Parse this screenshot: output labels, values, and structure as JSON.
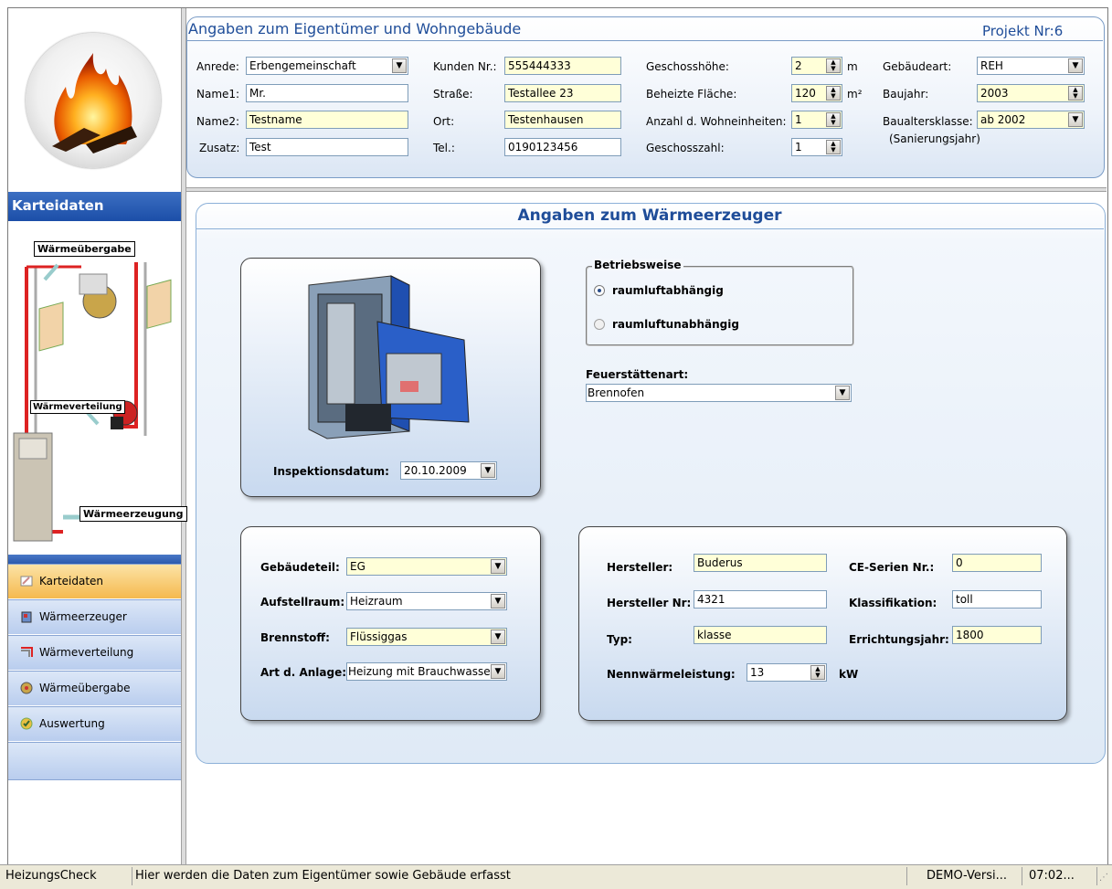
{
  "header": {
    "title": "Angaben zum Eigentümer und Wohngebäude",
    "project": "Projekt Nr:6",
    "fields": {
      "anrede": {
        "label": "Anrede:",
        "value": "Erbengemeinschaft"
      },
      "name1": {
        "label": "Name1:",
        "value": "Mr."
      },
      "name2": {
        "label": "Name2:",
        "value": "Testname"
      },
      "zusatz": {
        "label": "Zusatz:",
        "value": "Test"
      },
      "kunden_nr": {
        "label": "Kunden Nr.:",
        "value": "555444333"
      },
      "strasse": {
        "label": "Straße:",
        "value": "Testallee 23"
      },
      "ort": {
        "label": "Ort:",
        "value": "Testenhausen"
      },
      "tel": {
        "label": "Tel.:",
        "value": "0190123456"
      },
      "geschosshoehe": {
        "label": "Geschosshöhe:",
        "value": "2",
        "unit": "m"
      },
      "beheizte_flaeche": {
        "label": "Beheizte Fläche:",
        "value": "120",
        "unit": "m²"
      },
      "wohneinheiten": {
        "label": "Anzahl d. Wohneinheiten:",
        "value": "1"
      },
      "geschosszahl": {
        "label": "Geschosszahl:",
        "value": "1"
      },
      "gebaeudeart": {
        "label": "Gebäudeart:",
        "value": "REH"
      },
      "baujahr": {
        "label": "Baujahr:",
        "value": "2003"
      },
      "baualtersklasse": {
        "label": "Baualtersklasse:",
        "label2": "(Sanierungsjahr)",
        "value": "ab 2002"
      }
    }
  },
  "sidebar": {
    "header": "Karteidaten",
    "diagram_labels": {
      "uebergabe": "Wärmeübergabe",
      "verteilung": "Wärmeverteilung",
      "erzeugung": "Wärmeerzeugung"
    },
    "items": [
      {
        "label": "Karteidaten",
        "icon": "card-icon",
        "active": true
      },
      {
        "label": "Wärmeerzeuger",
        "icon": "boiler-icon",
        "active": false
      },
      {
        "label": "Wärmeverteilung",
        "icon": "distribution-icon",
        "active": false
      },
      {
        "label": "Wärmeübergabe",
        "icon": "radiator-icon",
        "active": false
      },
      {
        "label": "Auswertung",
        "icon": "evaluation-icon",
        "active": false
      }
    ]
  },
  "main": {
    "title": "Angaben zum Wärmeerzeuger",
    "inspektion": {
      "label": "Inspektionsdatum:",
      "value": "20.10.2009"
    },
    "betriebsweise": {
      "legend": "Betriebsweise",
      "options": [
        "raumluftabhängig",
        "raumluftunabhängig"
      ],
      "selected": 0
    },
    "feuerstaettenart": {
      "label": "Feuerstättenart:",
      "value": "Brennofen"
    },
    "left_box": {
      "gebaeudeteil": {
        "label": "Gebäudeteil:",
        "value": "EG"
      },
      "aufstellraum": {
        "label": "Aufstellraum:",
        "value": "Heizraum"
      },
      "brennstoff": {
        "label": "Brennstoff:",
        "value": "Flüssiggas"
      },
      "art_anlage": {
        "label": "Art d. Anlage:",
        "value": "Heizung mit Brauchwasse"
      }
    },
    "right_box": {
      "hersteller": {
        "label": "Hersteller:",
        "value": "Buderus"
      },
      "hersteller_nr": {
        "label": "Hersteller Nr:",
        "value": "4321"
      },
      "typ": {
        "label": "Typ:",
        "value": "klasse"
      },
      "nennwaermeleistung": {
        "label": "Nennwärmeleistung:",
        "value": "13",
        "unit": "kW"
      },
      "ce_serien_nr": {
        "label": "CE-Serien Nr.:",
        "value": "0"
      },
      "klassifikation": {
        "label": "Klassifikation:",
        "value": "toll"
      },
      "errichtungsjahr": {
        "label": "Errichtungsjahr:",
        "value": "1800"
      }
    }
  },
  "status": {
    "app": "HeizungsCheck",
    "message": "Hier werden die Daten zum Eigentümer sowie Gebäude erfasst",
    "version": "DEMO-Versi...",
    "time": "07:02..."
  },
  "colors": {
    "accent": "#1f4d99",
    "required_field": "#ffffd8",
    "active_nav": "#f5b94e",
    "nav": "#c7d7f1"
  }
}
